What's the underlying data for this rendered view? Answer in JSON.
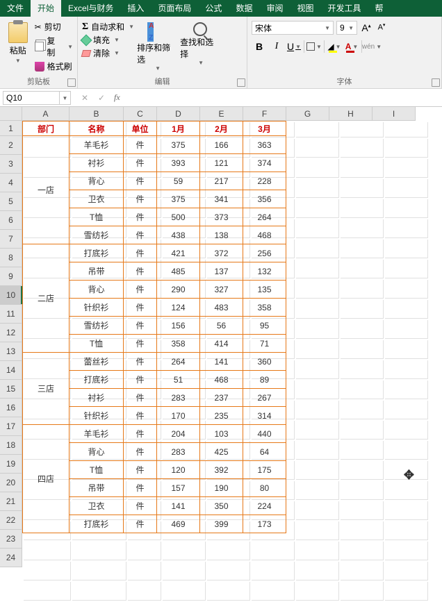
{
  "menu": {
    "tabs": [
      "文件",
      "开始",
      "Excel与财务",
      "插入",
      "页面布局",
      "公式",
      "数据",
      "审阅",
      "视图",
      "开发工具",
      "帮"
    ],
    "active_index": 1
  },
  "ribbon": {
    "clipboard": {
      "paste": "粘贴",
      "cut": "剪切",
      "copy": "复制",
      "format_painter": "格式刷",
      "group_label": "剪贴板"
    },
    "editing": {
      "autosum": "自动求和",
      "fill": "填充",
      "clear": "清除",
      "sort_filter": "排序和筛选",
      "find_select": "查找和选择",
      "group_label": "编辑"
    },
    "font": {
      "name": "宋体",
      "size": "9",
      "increase": "A",
      "decrease": "A",
      "bold": "B",
      "italic": "I",
      "underline": "U",
      "wen": "wén",
      "group_label": "字体"
    }
  },
  "formula_bar": {
    "name_box": "Q10",
    "cancel": "✕",
    "confirm": "✓",
    "fx": "fx",
    "formula": ""
  },
  "columns": [
    "A",
    "B",
    "C",
    "D",
    "E",
    "F",
    "G",
    "H",
    "I"
  ],
  "row_count": 24,
  "active_row": 10,
  "headers": {
    "dept": "部门",
    "name": "名称",
    "unit": "单位",
    "m1": "1月",
    "m2": "2月",
    "m3": "3月"
  },
  "unit_label": "件",
  "data": [
    {
      "dept": "一店",
      "rows": [
        {
          "name": "羊毛衫",
          "m1": 375,
          "m2": 166,
          "m3": 363
        },
        {
          "name": "衬衫",
          "m1": 393,
          "m2": 121,
          "m3": 374
        },
        {
          "name": "背心",
          "m1": 59,
          "m2": 217,
          "m3": 228
        },
        {
          "name": "卫衣",
          "m1": 375,
          "m2": 341,
          "m3": 356
        },
        {
          "name": "T恤",
          "m1": 500,
          "m2": 373,
          "m3": 264
        },
        {
          "name": "雪纺衫",
          "m1": 438,
          "m2": 138,
          "m3": 468
        }
      ]
    },
    {
      "dept": "二店",
      "rows": [
        {
          "name": "打底衫",
          "m1": 421,
          "m2": 372,
          "m3": 256
        },
        {
          "name": "吊带",
          "m1": 485,
          "m2": 137,
          "m3": 132
        },
        {
          "name": "背心",
          "m1": 290,
          "m2": 327,
          "m3": 135
        },
        {
          "name": "针织衫",
          "m1": 124,
          "m2": 483,
          "m3": 358
        },
        {
          "name": "雪纺衫",
          "m1": 156,
          "m2": 56,
          "m3": 95
        },
        {
          "name": "T恤",
          "m1": 358,
          "m2": 414,
          "m3": 71
        }
      ]
    },
    {
      "dept": "三店",
      "rows": [
        {
          "name": "蕾丝衫",
          "m1": 264,
          "m2": 141,
          "m3": 360
        },
        {
          "name": "打底衫",
          "m1": 51,
          "m2": 468,
          "m3": 89
        },
        {
          "name": "衬衫",
          "m1": 283,
          "m2": 237,
          "m3": 267
        },
        {
          "name": "针织衫",
          "m1": 170,
          "m2": 235,
          "m3": 314
        }
      ]
    },
    {
      "dept": "四店",
      "rows": [
        {
          "name": "羊毛衫",
          "m1": 204,
          "m2": 103,
          "m3": 440
        },
        {
          "name": "背心",
          "m1": 283,
          "m2": 425,
          "m3": 64
        },
        {
          "name": "T恤",
          "m1": 120,
          "m2": 392,
          "m3": 175
        },
        {
          "name": "吊带",
          "m1": 157,
          "m2": 190,
          "m3": 80
        },
        {
          "name": "卫衣",
          "m1": 141,
          "m2": 350,
          "m3": 224
        },
        {
          "name": "打底衫",
          "m1": 469,
          "m2": 399,
          "m3": 173
        }
      ]
    }
  ]
}
